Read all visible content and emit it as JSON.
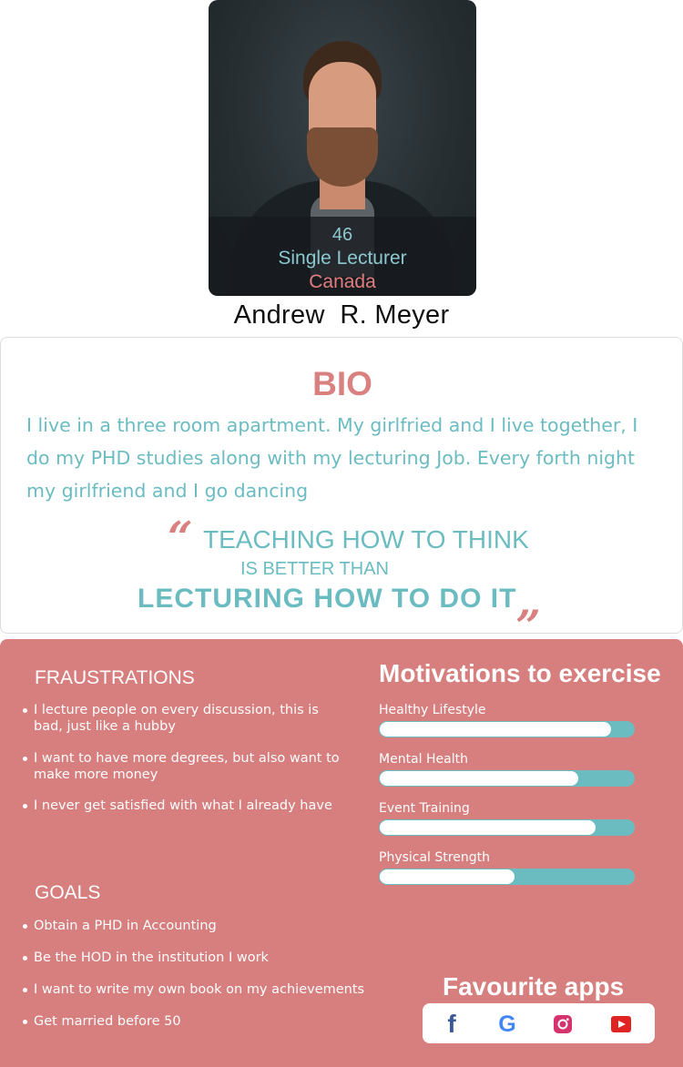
{
  "profile": {
    "age": "46",
    "occupation": "Single Lecturer",
    "location": "Canada",
    "name": "Andrew  R. Meyer"
  },
  "bio": {
    "title": "BIO",
    "text": "I live in a three room apartment. My girlfried and I live together, I do my PHD studies along with my lecturing Job. Every forth night my girlfriend and I go dancing",
    "quote": {
      "open_mark": "“",
      "line1": "TEACHING HOW TO THINK",
      "line2": "IS BETTER THAN",
      "line3": "LECTURING HOW TO DO IT",
      "close_mark": "„"
    }
  },
  "frustrations": {
    "title": "FRAUSTRATIONS",
    "items": [
      "I lecture people on every discussion, this is bad, just like a hubby",
      "I want to have more degrees, but also want to make more money",
      "I never get satisfied with what I already have"
    ]
  },
  "goals": {
    "title": "GOALS",
    "items": [
      "Obtain a PHD in Accounting",
      "Be the HOD in the institution I work",
      "I want to write my own book on my achievements",
      "Get married before 50"
    ]
  },
  "motivations": {
    "title": "Motivations to exercise",
    "items": [
      {
        "label": "Healthy Lifestyle",
        "level": 0.91
      },
      {
        "label": "Mental Health",
        "level": 0.78
      },
      {
        "label": "Event Training",
        "level": 0.85
      },
      {
        "label": "Physical Strength",
        "level": 0.53
      }
    ]
  },
  "apps": {
    "title": "Favourite apps",
    "items": [
      {
        "icon": "facebook-icon",
        "glyph": "f",
        "color": "#3b5998"
      },
      {
        "icon": "google-icon",
        "glyph": "G",
        "color": "#4285f4"
      },
      {
        "icon": "instagram-icon",
        "glyph": "",
        "color": "#d6336c"
      },
      {
        "icon": "youtube-icon",
        "glyph": "",
        "color": "#e02424"
      }
    ]
  },
  "colors": {
    "accent_pink": "#d77e7e",
    "accent_teal": "#6bbcc1"
  }
}
